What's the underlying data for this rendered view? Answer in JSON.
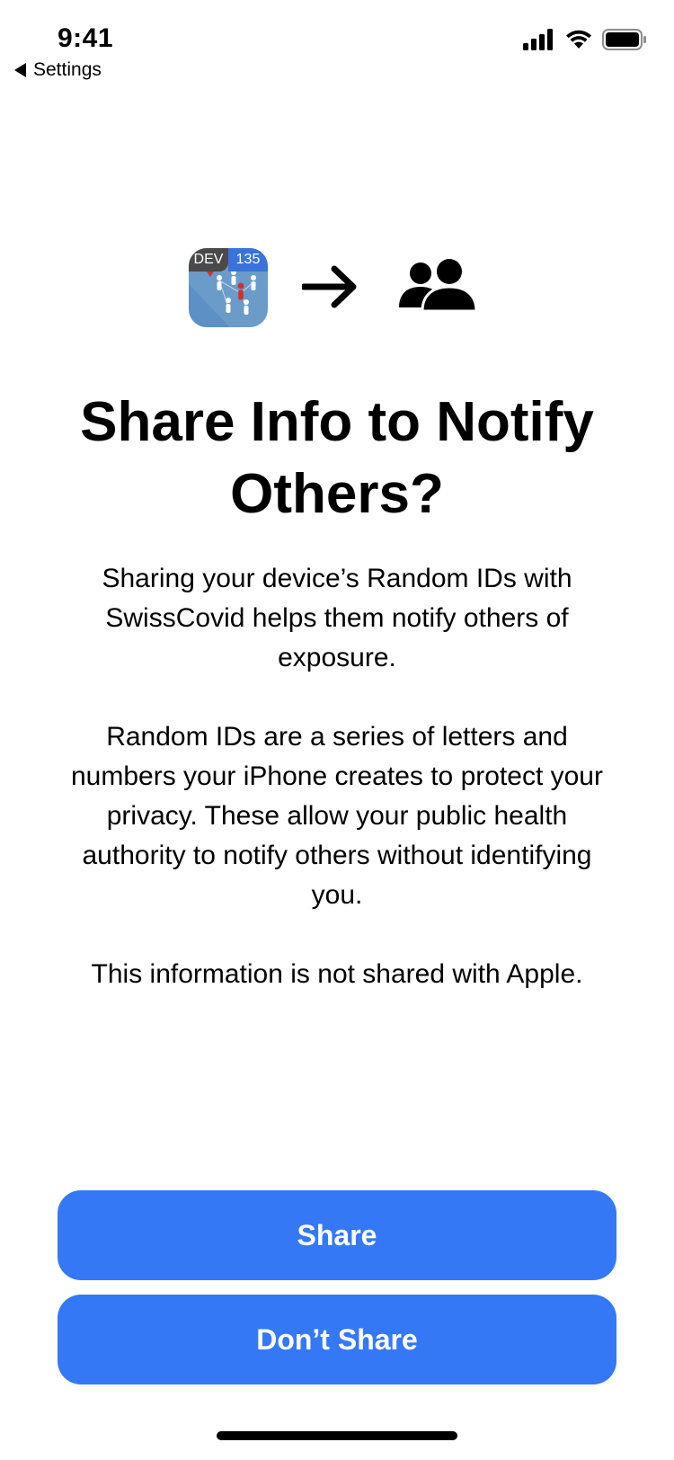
{
  "status_bar": {
    "time": "9:41",
    "back_label": "Settings",
    "icons": [
      "cellular-signal-icon",
      "wifi-icon",
      "battery-icon"
    ]
  },
  "hero": {
    "app_icon": {
      "badge_left": "DEV",
      "badge_right": "135",
      "name": "swisscovid-app-icon"
    },
    "arrow": "arrow-right-icon",
    "group": "people-group-icon"
  },
  "title": "Share Info to Notify Others?",
  "paragraphs": {
    "p1": "Sharing your device’s Random IDs with SwissCovid helps them notify others of exposure.",
    "p2": "Random IDs are a series of letters and numbers your iPhone creates to protect your privacy. These allow your public health authority to notify others without identifying you.",
    "p3": "This information is not shared with Apple."
  },
  "buttons": {
    "share_label": "Share",
    "dont_share_label": "Don’t Share"
  },
  "colors": {
    "accent": "#3478f6",
    "background": "#ffffff",
    "text": "#000000"
  }
}
